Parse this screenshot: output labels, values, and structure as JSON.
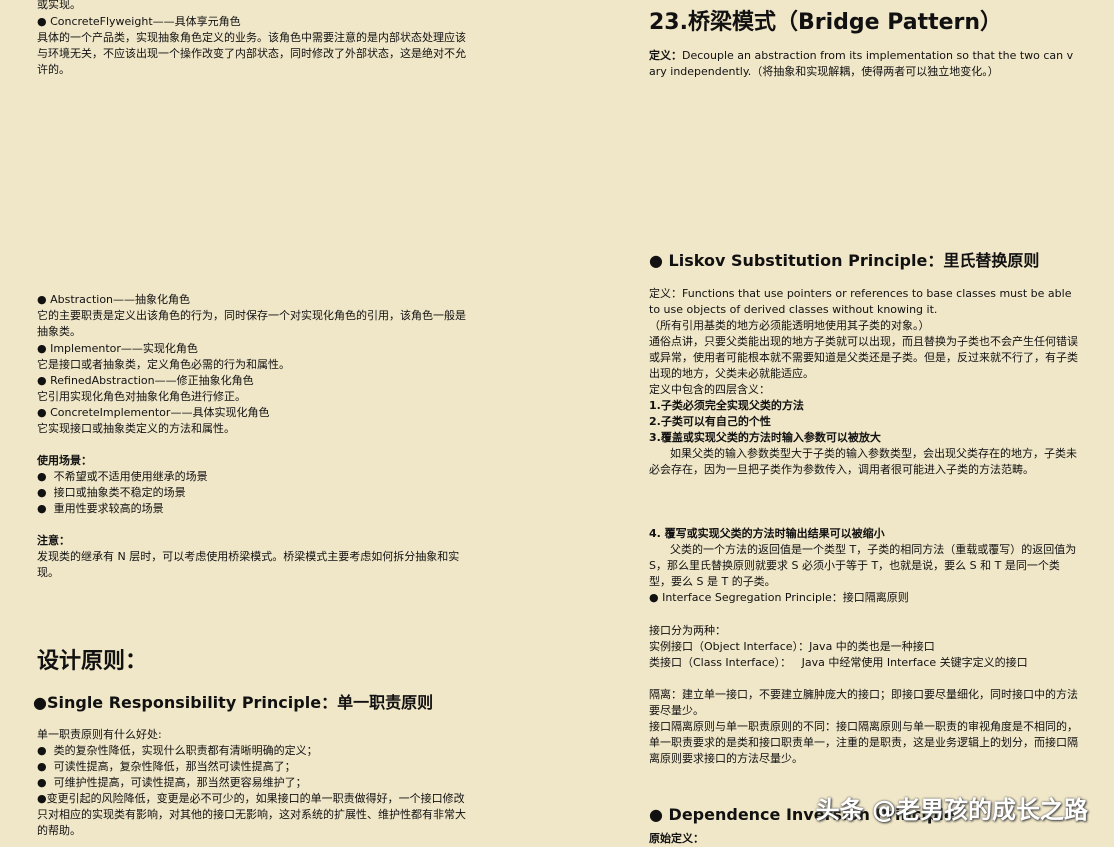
{
  "left": {
    "top_line": "或实现。",
    "flyweight_item": "● ConcreteFlyweight——具体享元角色",
    "flyweight_desc": "具体的一个产品类，实现抽象角色定义的业务。该角色中需要注意的是内部状态处理应该与环境无关，不应该出现一个操作改变了内部状态，同时修改了外部状态，这是绝对不允许的。",
    "abstraction_item": "● Abstraction——抽象化角色",
    "abstraction_desc": "它的主要职责是定义出该角色的行为，同时保存一个对实现化角色的引用，该角色一般是抽象类。",
    "implementor_item": "● Implementor——实现化角色",
    "implementor_desc": "它是接口或者抽象类，定义角色必需的行为和属性。",
    "refined_item": "● RefinedAbstraction——修正抽象化角色",
    "refined_desc": "它引用实现化角色对抽象化角色进行修正。",
    "concrete_impl_item": "● ConcreteImplementor——具体实现化角色",
    "concrete_impl_desc": "它实现接口或抽象类定义的方法和属性。",
    "usage_title": "使用场景：",
    "usage_items": [
      "●  不希望或不适用使用继承的场景",
      "●  接口或抽象类不稳定的场景",
      "●  重用性要求较高的场景"
    ],
    "note_title": "注意：",
    "note_desc": "发现类的继承有 N 层时，可以考虑使用桥梁模式。桥梁模式主要考虑如何拆分抽象和实现。",
    "design_title": "设计原则：",
    "srp_title": "●Single Responsibility Principle：单一职责原则",
    "srp_intro": "单一职责原则有什么好处:",
    "srp_items": [
      "●  类的复杂性降低，实现什么职责都有清晰明确的定义；",
      "●  可读性提高，复杂性降低，那当然可读性提高了；",
      "●  可维护性提高，可读性提高，那当然更容易维护了；",
      "●变更引起的风险降低，变更是必不可少的，如果接口的单一职责做得好，一个接口修改只对相应的实现类有影响，对其他的接口无影响，这对系统的扩展性、维护性都有非常大的帮助。"
    ]
  },
  "right": {
    "bridge_title": "23.桥梁模式（Bridge Pattern）",
    "bridge_def_label": "定义：",
    "bridge_def": "Decouple an abstraction from its implementation so that the two can vary independently.（将抽象和实现解耦，使得两者可以独立地变化。）",
    "liskov_title": "● Liskov Substitution Principle：里氏替换原则",
    "liskov_def": "定义：Functions that use pointers or references to base classes must be able to use objects of derived classes without knowing it.",
    "liskov_def_cn": "（所有引用基类的地方必须能透明地使用其子类的对象。）",
    "liskov_plain": "通俗点讲，只要父类能出现的地方子类就可以出现，而且替换为子类也不会产生任何错误或异常，使用者可能根本就不需要知道是父类还是子类。但是，反过来就不行了，有子类出现的地方，父类未必就能适应。",
    "liskov_layers": "定义中包含的四层含义：",
    "rule1": "1.子类必须完全实现父类的方法",
    "rule2": "2.子类可以有自己的个性",
    "rule3": "3.覆盖或实现父类的方法时输入参数可以被放大",
    "rule3_desc": "      如果父类的输入参数类型大于子类的输入参数类型，会出现父类存在的地方，子类未必会存在，因为一旦把子类作为参数传入，调用者很可能进入子类的方法范畴。",
    "rule4": "4. 覆写或实现父类的方法时输出结果可以被缩小",
    "rule4_desc": "      父类的一个方法的返回值是一个类型 T，子类的相同方法（重载或覆写）的返回值为 S，那么里氏替换原则就要求 S 必须小于等于 T，也就是说，要么 S 和 T 是同一个类型，要么 S 是 T 的子类。",
    "isp_item": "● Interface Segregation Principle：接口隔离原则",
    "interface_kinds": "接口分为两种：",
    "instance_iface": "实例接口（Object Interface）：Java 中的类也是一种接口",
    "class_iface": "类接口（Class Interface）：   Java 中经常使用 Interface 关键字定义的接口",
    "isolation": "隔离：建立单一接口，不要建立臃肿庞大的接口；即接口要尽量细化，同时接口中的方法要尽量少。",
    "isp_vs_srp": "接口隔离原则与单一职责原则的不同：接口隔离原则与单一职责的审视角度是不相同的，单一职责要求的是类和接口职责单一，注重的是职责，这是业务逻辑上的划分，而接口隔离原则要求接口的方法尽量少。",
    "dip_title": "● Dependence Inversion Principle",
    "original_def": "原始定义："
  },
  "watermark": "头条 @老男孩的成长之路"
}
